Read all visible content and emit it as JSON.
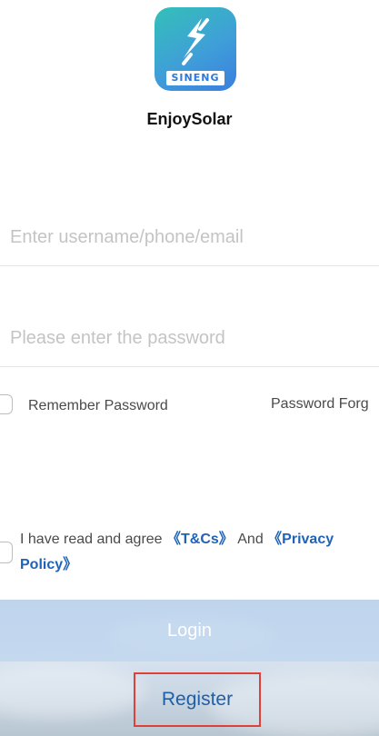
{
  "app": {
    "logo_text": "SINENG",
    "name": "EnjoySolar"
  },
  "login_form": {
    "username_placeholder": "Enter username/phone/email",
    "username_value": "",
    "password_placeholder": "Please enter the password",
    "password_value": "",
    "remember_label": "Remember Password",
    "remember_checked": false,
    "forgot_label": "Password Forg"
  },
  "agreement": {
    "prefix": "I have read and agree ",
    "tc_link": "《T&Cs》",
    "middle": " And ",
    "privacy_link": "《Privacy Policy》",
    "checked": false
  },
  "actions": {
    "login_label": "Login",
    "register_label": "Register"
  },
  "colors": {
    "link": "#1e63b8",
    "highlight_border": "#e0403a",
    "logo_gradient_start": "#33c0b8",
    "logo_gradient_end": "#3b7ee0"
  },
  "icons": [
    "app-logo-icon",
    "checkbox-icon"
  ]
}
